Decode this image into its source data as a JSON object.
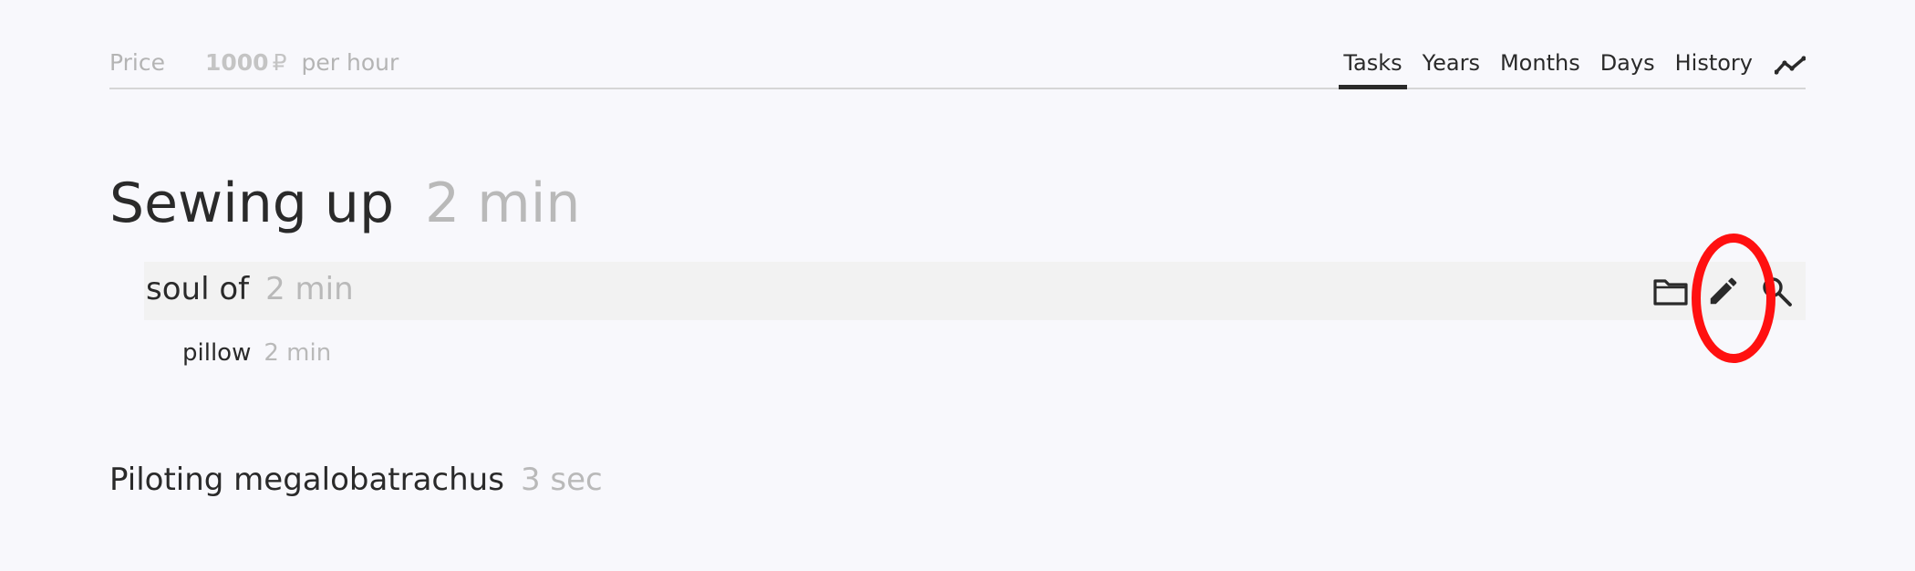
{
  "header": {
    "price_label": "Price",
    "price_value": "1000",
    "price_currency": "₽",
    "price_unit": "per hour",
    "tabs": [
      {
        "label": "Tasks",
        "active": true
      },
      {
        "label": "Years",
        "active": false
      },
      {
        "label": "Months",
        "active": false
      },
      {
        "label": "Days",
        "active": false
      },
      {
        "label": "History",
        "active": false
      }
    ],
    "trend_icon": "trend-line-icon"
  },
  "sections": [
    {
      "name": "Sewing up",
      "duration": "2 min",
      "rows": [
        {
          "name": "soul of",
          "duration": "2 min",
          "actions": [
            "folder-icon",
            "pencil-icon",
            "search-icon"
          ],
          "children": [
            {
              "name": "pillow",
              "duration": "2 min"
            }
          ]
        }
      ]
    },
    {
      "name": "Piloting megalobatrachus",
      "duration": "3 sec",
      "rows": []
    }
  ],
  "colors": {
    "background": "#f8f8fc",
    "text": "#2a2a2a",
    "muted": "#b9b9b9",
    "row_bg": "#f2f2f2",
    "annotation": "#ff1010"
  }
}
